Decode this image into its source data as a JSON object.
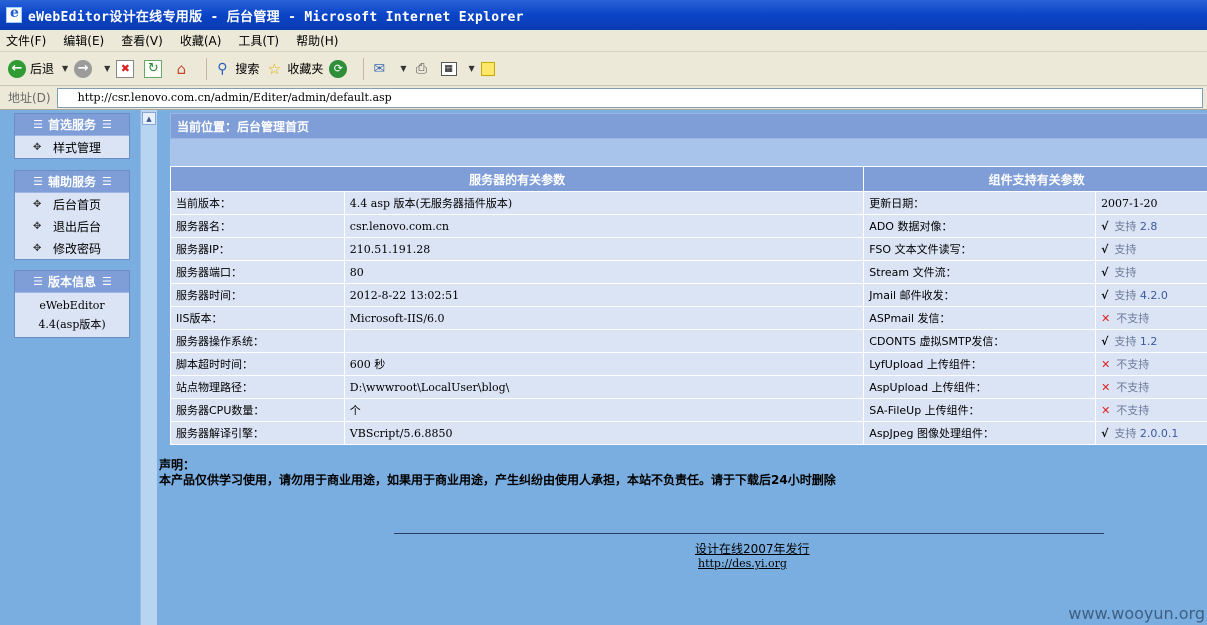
{
  "window": {
    "title": "eWebEditor设计在线专用版 - 后台管理 - Microsoft Internet Explorer"
  },
  "menubar": [
    "文件(F)",
    "编辑(E)",
    "查看(V)",
    "收藏(A)",
    "工具(T)",
    "帮助(H)"
  ],
  "toolbar": {
    "back_label": "后退",
    "search_label": "搜索",
    "favorites_label": "收藏夹"
  },
  "address": {
    "label": "地址(D)",
    "url": "http://csr.lenovo.com.cn/admin/Editer/admin/default.asp"
  },
  "sidebar": {
    "preferred": {
      "title": "首选服务",
      "items": [
        "样式管理"
      ]
    },
    "aux": {
      "title": "辅助服务",
      "items": [
        "后台首页",
        "退出后台",
        "修改密码"
      ]
    },
    "version": {
      "title": "版本信息",
      "line1": "eWebEditor",
      "line2": "4.4(asp版本)"
    }
  },
  "location": "当前位置：后台管理首页",
  "table": {
    "server_header": "服务器的有关参数",
    "component_header": "组件支持有关参数",
    "rows": [
      {
        "label": "当前版本：",
        "value": "4.4 asp 版本(无服务器插件版本)",
        "comp": "更新日期：",
        "status": "2007-1-20",
        "support": "date",
        "ver": ""
      },
      {
        "label": "服务器名：",
        "value": "csr.lenovo.com.cn",
        "comp": "ADO 数据对像：",
        "status": "支持",
        "support": "yes",
        "ver": "2.8"
      },
      {
        "label": "服务器IP：",
        "value": "210.51.191.28",
        "comp": "FSO 文本文件读写：",
        "status": "支持",
        "support": "yes",
        "ver": ""
      },
      {
        "label": "服务器端口：",
        "value": "80",
        "comp": "Stream 文件流：",
        "status": "支持",
        "support": "yes",
        "ver": ""
      },
      {
        "label": "服务器时间：",
        "value": "2012-8-22 13:02:51",
        "comp": "Jmail 邮件收发：",
        "status": "支持",
        "support": "yes",
        "ver": "4.2.0"
      },
      {
        "label": "IIS版本：",
        "value": "Microsoft-IIS/6.0",
        "comp": "ASPmail 发信：",
        "status": "不支持",
        "support": "no",
        "ver": ""
      },
      {
        "label": "服务器操作系统：",
        "value": "",
        "comp": "CDONTS 虚拟SMTP发信：",
        "status": "支持",
        "support": "yes",
        "ver": "1.2"
      },
      {
        "label": "脚本超时时间：",
        "value": "600 秒",
        "comp": "LyfUpload 上传组件：",
        "status": "不支持",
        "support": "no",
        "ver": ""
      },
      {
        "label": "站点物理路径：",
        "value": "D:\\wwwroot\\LocalUser\\blog\\",
        "comp": "AspUpload 上传组件：",
        "status": "不支持",
        "support": "no",
        "ver": ""
      },
      {
        "label": "服务器CPU数量：",
        "value": "个",
        "comp": "SA-FileUp 上传组件：",
        "status": "不支持",
        "support": "no",
        "ver": ""
      },
      {
        "label": "服务器解译引擎：",
        "value": "VBScript/5.6.8850",
        "comp": "AspJpeg 图像处理组件：",
        "status": "支持",
        "support": "yes",
        "ver": "2.0.0.1"
      }
    ]
  },
  "notice": {
    "title": "声明：",
    "text": "本产品仅供学习使用，请勿用于商业用途，如果用于商业用途，产生纠纷由使用人承担，本站不负责任。请于下载后24小时删除"
  },
  "footer": {
    "publisher": "设计在线2007年发行",
    "url": "http://des.yi.org"
  },
  "watermark": "www.wooyun.org"
}
